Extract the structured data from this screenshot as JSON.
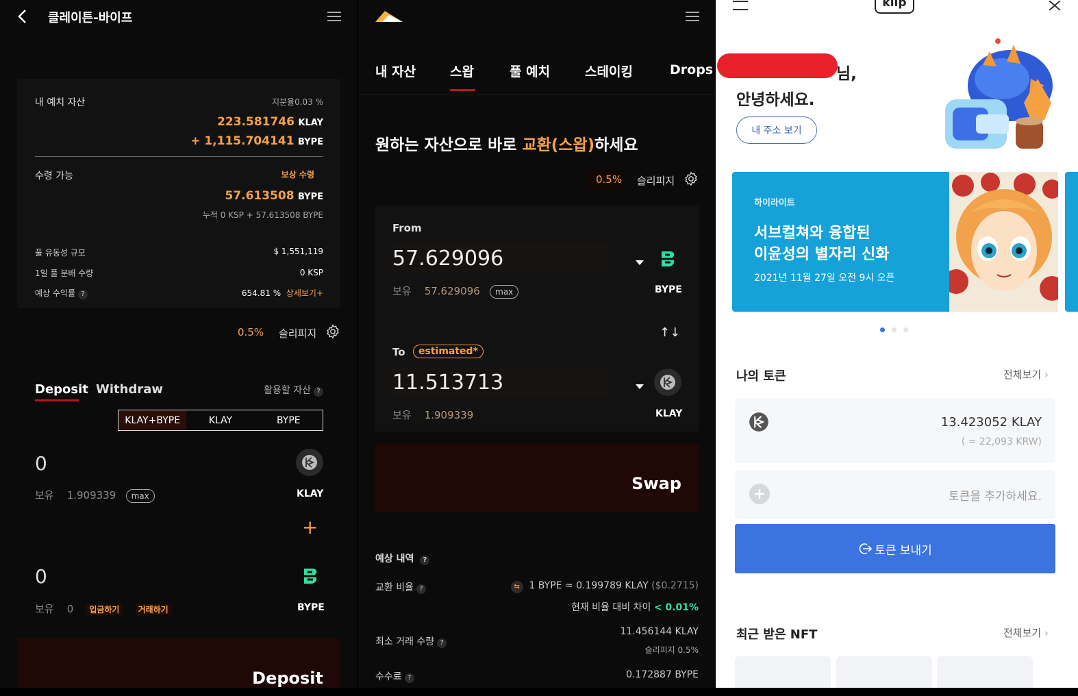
{
  "p1": {
    "title": "클레이튼-바이프",
    "deposit_assets_label": "내 예치 자산",
    "share_label": "지분율",
    "share_value": "0.03 %",
    "klay_amount": "223.581746",
    "klay_unit": "KLAY",
    "bype_amount": "+ 1,115.704141",
    "bype_unit": "BYPE",
    "claimable_label": "수령 가능",
    "claim_button": "보상 수령",
    "claim_amount": "57.613508",
    "claim_unit": "BYPE",
    "cumulative": "누적 0 KSP + 57.613508 BYPE",
    "pool_size_label": "풀 유동성 규모",
    "pool_size_value": "$ 1,551,119",
    "daily_label": "1일 풀 분배 수량",
    "daily_value": "0 KSP",
    "apr_label": "예상 수익률",
    "apr_value": "654.81 %",
    "apr_detail": "상세보기+",
    "slippage_value": "0.5%",
    "slippage_label": "슬리피지",
    "tab_deposit": "Deposit",
    "tab_withdraw": "Withdraw",
    "assets_to_use": "활용할 자산",
    "seg": [
      "KLAY+BYPE",
      "KLAY",
      "BYPE"
    ],
    "klay_input": "0",
    "hold_label": "보유",
    "klay_hold": "1.909339",
    "max_label": "max",
    "klay_token": "KLAY",
    "plus": "+",
    "bype_input": "0",
    "bype_hold": "0",
    "deposit_link": "입금하기",
    "trade_link": "거래하기",
    "bype_token": "BYPE",
    "deposit_button": "Deposit"
  },
  "p2": {
    "nav": [
      "내 자산",
      "스왑",
      "풀 예치",
      "스테이킹",
      "Drops"
    ],
    "headline_a": "원하는 자산으로 바로 ",
    "headline_b": "교환(스왑)",
    "headline_c": "하세요",
    "slippage_value": "0.5%",
    "slippage_label": "슬리피지",
    "from_label": "From",
    "from_value": "57.629096",
    "hold_label": "보유",
    "from_hold": "57.629096",
    "max_label": "max",
    "from_token": "BYPE",
    "swap_arrows": "↑↓",
    "to_label": "To",
    "estimated": "estimated*",
    "to_value": "11.513713",
    "to_hold": "1.909339",
    "to_token": "KLAY",
    "swap_button": "Swap",
    "expected_label": "예상 내역",
    "rate_label": "교환 비율",
    "rate_value": "1 BYPE ≈ 0.199789 KLAY",
    "rate_usd": "($0.2715)",
    "rate_diff_label": "현재 비율 대비 차이",
    "rate_diff_value": "< 0.01%",
    "min_label": "최소 거래 수량",
    "min_value": "11.456144 KLAY",
    "min_slip": "슬리피지 0.5%",
    "fee_label": "수수료",
    "fee_value": "0.172887 BYPE"
  },
  "p3": {
    "logo": "klip",
    "greeting_suffix": "님,",
    "greeting": "안녕하세요.",
    "address_button": "내 주소 보기",
    "banner_tag": "하이라이트",
    "banner_line1": "서브컬쳐와 융합된",
    "banner_line2": "이윤성의 별자리 신화",
    "banner_date": "2021년 11월 27일 오전 9시 오픈",
    "my_tokens": "나의 토큰",
    "view_all": "전체보기",
    "klay_balance": "13.423052 KLAY",
    "klay_krw": "( ≈ 22,093 KRW)",
    "add_token": "토큰을 추가하세요.",
    "send_button": "토큰 보내기",
    "recent_nft": "최근 받은 NFT",
    "view_all2": "전체보기",
    "colors": {
      "blue": "#3b73e0",
      "banner": "#16a2d8",
      "redact": "#e8202a"
    }
  }
}
